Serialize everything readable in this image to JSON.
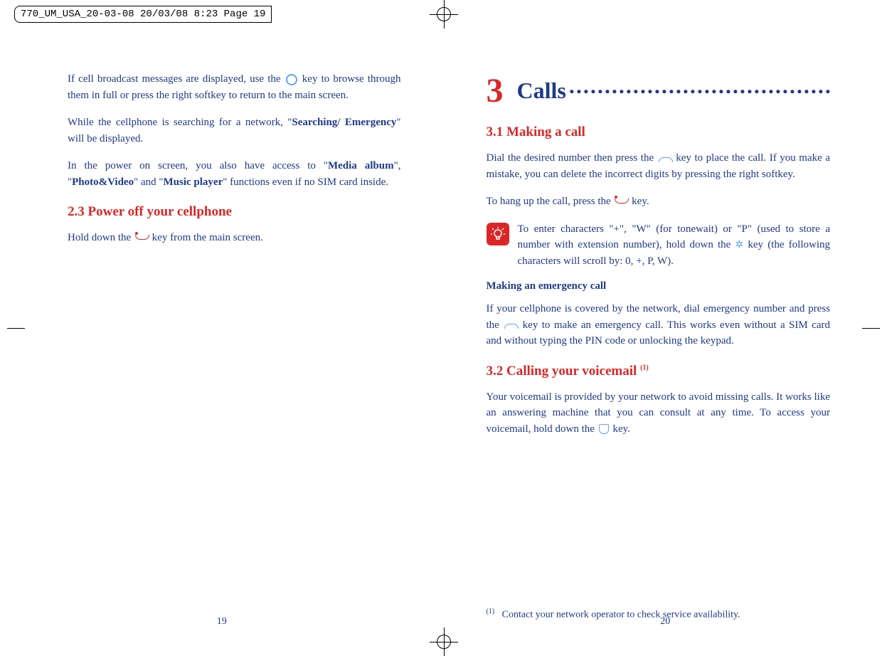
{
  "header": {
    "slug": "770_UM_USA_20-03-08  20/03/08  8:23  Page 19"
  },
  "left_page": {
    "para1_part1": "If cell broadcast messages are displayed, use the ",
    "para1_part2": " key to browse through them in full or press the right softkey to return to the main screen.",
    "para2_part1": "While the cellphone is searching for a network, \"",
    "para2_bold1": "Searching/ Emergency",
    "para2_part2": "\" will be displayed.",
    "para3_part1": "In the power on screen, you also have access to \"",
    "para3_bold1": "Media album",
    "para3_part2": "\", \"",
    "para3_bold2": "Photo&Video",
    "para3_part3": "\" and \"",
    "para3_bold3": "Music player",
    "para3_part4": "\" functions even if no SIM card inside.",
    "section_2_3": "2.3     Power off your cellphone",
    "para4_part1": "Hold down the ",
    "para4_part2": " key from the main screen.",
    "page_num": "19"
  },
  "right_page": {
    "chapter_num": "3",
    "chapter_title": "Calls",
    "chapter_dots": ".....................................",
    "section_3_1": "3.1     Making a call",
    "para1_part1": "Dial the desired number then press the ",
    "para1_part2": " key to place the call. If you make a mistake, you can delete the incorrect digits by pressing the right softkey.",
    "para2_part1": "To hang up the call, press the ",
    "para2_part2": " key.",
    "tip_part1": "To enter characters \"+\", \"W\" (for tonewait) or \"P\" (used to store a number with extension number), hold down the ",
    "tip_part2": " key (the following characters will scroll by: 0, +, P, W).",
    "subheading1": "Making an emergency call",
    "para3_part1": "If your cellphone is covered by the network, dial emergency number and press the ",
    "para3_part2": " key to make an emergency call. This works even without a SIM card and without typing the PIN code or unlocking the keypad.",
    "section_3_2_part1": "3.2     Calling your voicemail ",
    "section_3_2_sup": "(1)",
    "para4_part1": "Your voicemail is provided by your network to avoid missing calls. It works like an answering machine that you can consult at any time. To access your voicemail, hold down the ",
    "para4_part2": " key.",
    "footnote_marker": "(1)",
    "footnote_text": "Contact your network operator to check service availability.",
    "page_num": "20"
  }
}
